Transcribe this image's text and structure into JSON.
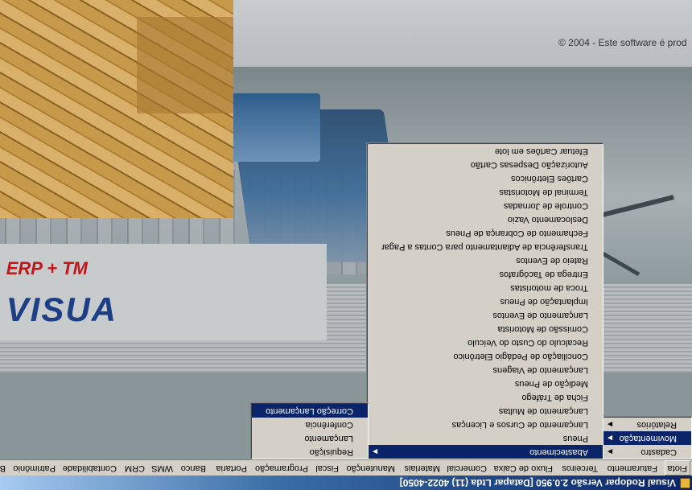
{
  "window": {
    "title": "Visual Rodopar Versão 2.0.950 [Datapar Ltda (11) 4022-4050]"
  },
  "menubar": {
    "items": [
      "Fiota",
      "Faturamento",
      "Terceiros",
      "Fluxo de Caixa",
      "Comercial",
      "Materiais",
      "Manutenção",
      "Fiscal",
      "Programação",
      "Portaria",
      "Banco",
      "WMS",
      "CRM",
      "Contabilidade",
      "Patrimônio",
      "B"
    ]
  },
  "menu_fiota": {
    "items": [
      "Cadastro",
      "Movimentação",
      "Relatórios"
    ],
    "selected": "Movimentação"
  },
  "menu_movimentacao": {
    "items": [
      "Abastecimento",
      "Pneus",
      "Lançamento de Cursos e Licenças",
      "Lançamento de Multas",
      "Ficha de Tráfego",
      "Medição de Pneus",
      "Lançamento de Viagens",
      "Conciliação de Pedágio Eletrônico",
      "Recalculo do Custo do Veículo",
      "Comissão de Motorista",
      "Lançamento de Eventos",
      "Implantação de Pneus",
      "Troca de motoristas",
      "Entrega de Tacógrafos",
      "Rateio de Eventos",
      "Transferência de Adiantamento para Contas a Pagar",
      "Fechamento de Cobrança de Pneus",
      "Deslocamento Vazio",
      "Controle de Jornadas",
      "Terminal de Motoristas",
      "Cartões Eletrônicos",
      "Autorização Despesas Cartão",
      "Efetuar Cartões em lote"
    ],
    "selected": "Abastecimento"
  },
  "menu_abastecimento": {
    "items": [
      "Requisição",
      "Lançamento",
      "Conferência",
      "Correção Lançamento"
    ],
    "selected": "Correção Lançamento"
  },
  "splash": {
    "copyright": "© 2004 - Este software é prod",
    "logo_main": "VISUA",
    "logo_sub": "ERP + TM"
  },
  "colors": {
    "titlebar": "#0a246a",
    "menu_bg": "#d4d0c8",
    "menu_highlight": "#0a246a"
  }
}
